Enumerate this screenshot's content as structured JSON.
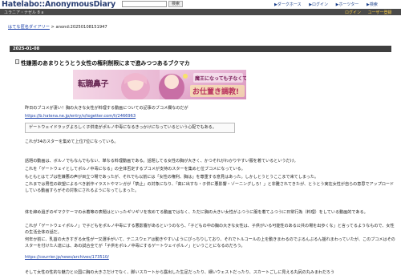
{
  "header": {
    "logo": "Hatelabo::AnonymousDiary",
    "search_button": "検索",
    "links": [
      "▶ダークホース",
      "▶ログイン",
      "▶ホーツター",
      "▶検索"
    ]
  },
  "navbar": {
    "left": "ユラニア・ナゼル 8 a",
    "right": [
      "ログイン",
      "ユーザー登録"
    ]
  },
  "breadcrumb": {
    "link": "はてな匿名ダイアリー",
    "separator": " > ",
    "current": "anond:20250108151947"
  },
  "date": "2025-01-08",
  "title": "性嫌悪のあまりとうとう女性の権利制限にまで進みつつあるブクマカ",
  "banner": {
    "left_text": "転職鼻子",
    "right_top": "魔王になっても子なくて",
    "right_bottom": "お仕置き調教!"
  },
  "body": [
    "昨日のブコメが凄い！胸の大きな女性が料理する動画についての記事のブコメ欄なのだが",
    "https://b.hatena.ne.jp/entry/s/togetter.com/li/2466963",
    "ゲートウェイドラッグよろしく子供達がポルノ中毒になるきっかけになっているという心配でもある。",
    "これが34のスターを集めて上位7位になっている。",
    "話題の動画は、ボルノでもなんでもない、単なる料理動画である。話題してる女性の胸が大きく、かつそれがわかりやすい服を着ているというだけ。",
    "これを「ゲートウェイとしてポルノ中毒になる」の全体否定するブコメが支持のスターを集めと位ブコメになっている。",
    "もともとはてブは性嫌悪の声が目立つ場であったが、それでも以前には「女性の権利、胸は」を尊重する意見はあった。しかしとうとうここまで来てしまった。",
    "これまでは男性の欲望によるべき創作イラストやマンガが「禁止」の対象になり、「高に出すな・子供に悪影響・ゾーニングしろ！」と非難されてきたが、とうとう実在女性が自らの意思でアップロードしている動画すらがその対象にされるようになってしまった。",
    "体を締め過ぎのギマクケーマの水着等の表題はといったギリギリを攻めてる動画ではなく、ただに胸の大きい女性がふつうに服を着てふつうに日常行為（料理）をしている動画的である。",
    "これが「ゲートウェイポルノ」で子どもをポルノ中毒にする悪影響があるというのなら、「子どもの中の胸の大きな女性は、子供がいる可能性のある公共の場を出歩くな」と言ってるようなもので、女性の生活全体の話だ。",
    "何年か前に、乳首の大きすぎる女性が一又選手がいて、テニスウェアは動きやすいようにぴっちりしており、それでトルコールの上を動きまわるのでぶるんぶるん揺れまわっていたが、このブコメはそのスターを付けた人達には、あの試合全てが「子供をポルノ中毒にするゲートウェイポルノ」ということになるのだろう。",
    "https://courrier.jp/news/archives/173510/",
    "そして女性の性的な魅力と公国に胸の大きさだけでなく、脚いスカートから露出した生足だったり、細いウェストだったり、スカートごしに見える丸尻の丸みまわだろう"
  ]
}
